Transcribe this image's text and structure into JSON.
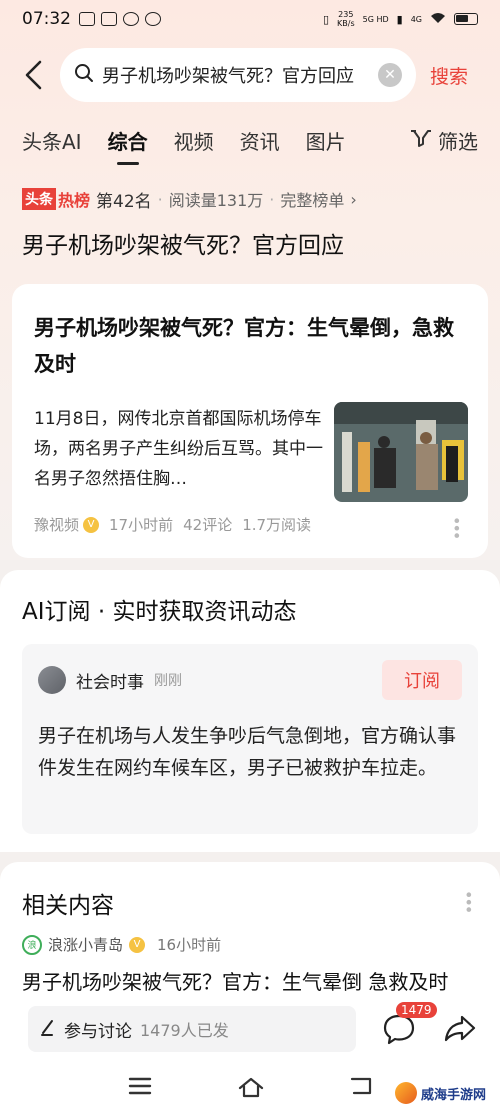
{
  "status_bar": {
    "time": "07:32",
    "speed_value": "235",
    "speed_unit": "KB/s",
    "network_1": "5G HD",
    "network_2": "4G"
  },
  "search": {
    "query": "男子机场吵架被气死？官方回应",
    "action_label": "搜索"
  },
  "tabs": [
    {
      "label": "头条AI"
    },
    {
      "label": "综合",
      "active": true
    },
    {
      "label": "视频"
    },
    {
      "label": "资讯"
    },
    {
      "label": "图片"
    }
  ],
  "filter_label": "筛选",
  "hot": {
    "logo_a": "头条",
    "logo_b": "热榜",
    "rank": "第42名",
    "reads": "阅读量131万",
    "full_list": "完整榜单",
    "title": "男子机场吵架被气死？官方回应"
  },
  "news": {
    "title": "男子机场吵架被气死？官方：生气晕倒，急救及时",
    "snippet": "11月8日，网传北京首都国际机场停车场，两名男子产生纠纷后互骂。其中一名男子忽然捂住胸…",
    "source": "豫视频",
    "time": "17小时前",
    "comments": "42评论",
    "reads": "1.7万阅读"
  },
  "ai_card": {
    "title": "AI订阅 · 实时获取资讯动态",
    "source_name": "社会时事",
    "source_time": "刚刚",
    "subscribe_label": "订阅",
    "text": "男子在机场与人发生争吵后气急倒地，官方确认事件发生在网约车候车区，男子已被救护车拉走。"
  },
  "related": {
    "title": "相关内容",
    "source": "浪涨小青岛",
    "time": "16小时前",
    "headline": "男子机场吵架被气死？官方：生气晕倒 急救及时"
  },
  "action_bar": {
    "discuss_label": "参与讨论",
    "discuss_count": "1479人已发",
    "comment_badge": "1479"
  },
  "watermark": "威海手游网",
  "colors": {
    "accent": "#e8423a",
    "verified": "#f5c242"
  },
  "icons": [
    "back-icon",
    "search-icon",
    "clear-icon",
    "filter-icon",
    "chevron-right-icon",
    "more-icon",
    "comment-icon",
    "share-icon",
    "menu-icon",
    "home-icon",
    "back-nav-icon",
    "pen-icon",
    "verified-icon"
  ]
}
